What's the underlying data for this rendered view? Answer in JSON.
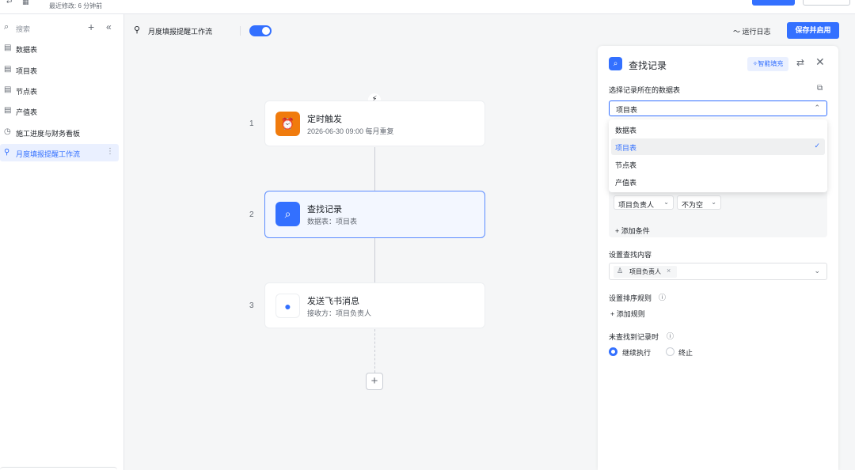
{
  "topbar": {
    "last_modified": "最近修改: 6 分钟前"
  },
  "sidebar": {
    "search_placeholder": "搜索",
    "items": [
      {
        "icon": "table-icon",
        "label": "数据表"
      },
      {
        "icon": "table-icon",
        "label": "项目表"
      },
      {
        "icon": "table-icon",
        "label": "节点表"
      },
      {
        "icon": "table-icon",
        "label": "产值表"
      },
      {
        "icon": "dashboard-icon",
        "label": "施工进度与财务看板"
      },
      {
        "icon": "workflow-icon",
        "label": "月度填报提醒工作流",
        "active": true
      }
    ]
  },
  "workflow": {
    "title": "月度填报提醒工作流",
    "enabled": true,
    "run_log": "运行日志",
    "save_label": "保存并启用",
    "nodes": [
      {
        "index": "1",
        "title": "定时触发",
        "subtitle": "2026-06-30 09:00 每月重复",
        "icon": "alarm-clock-icon",
        "color": "#f07b0d"
      },
      {
        "index": "2",
        "title": "查找记录",
        "subtitle": "数据表：项目表",
        "icon": "search-icon",
        "color": "#3370ff",
        "selected": true
      },
      {
        "index": "3",
        "title": "发送飞书消息",
        "subtitle": "接收方：项目负责人",
        "icon": "feishu-message-icon",
        "color": "#3370ff"
      }
    ]
  },
  "panel": {
    "title": "查找记录",
    "smart_fill": "智能填充",
    "table_label": "选择记录所在的数据表",
    "table_value": "项目表",
    "table_options": [
      {
        "label": "数据表",
        "selected": false
      },
      {
        "label": "项目表",
        "selected": true
      },
      {
        "label": "节点表",
        "selected": false
      },
      {
        "label": "产值表",
        "selected": false
      }
    ],
    "condition": {
      "field": "项目负责人",
      "operator": "不为空",
      "add_label": "添加条件"
    },
    "content_label": "设置查找内容",
    "content_tag": "项目负责人",
    "sort_label": "设置排序规则",
    "add_rule": "添加规则",
    "not_found_label": "未查找到记录时",
    "not_found_options": [
      {
        "label": "继续执行",
        "checked": true
      },
      {
        "label": "终止",
        "checked": false
      }
    ]
  },
  "colors": {
    "accent": "#3370ff",
    "trigger": "#f07b0d",
    "canvas_bg": "#f5f6f7"
  }
}
